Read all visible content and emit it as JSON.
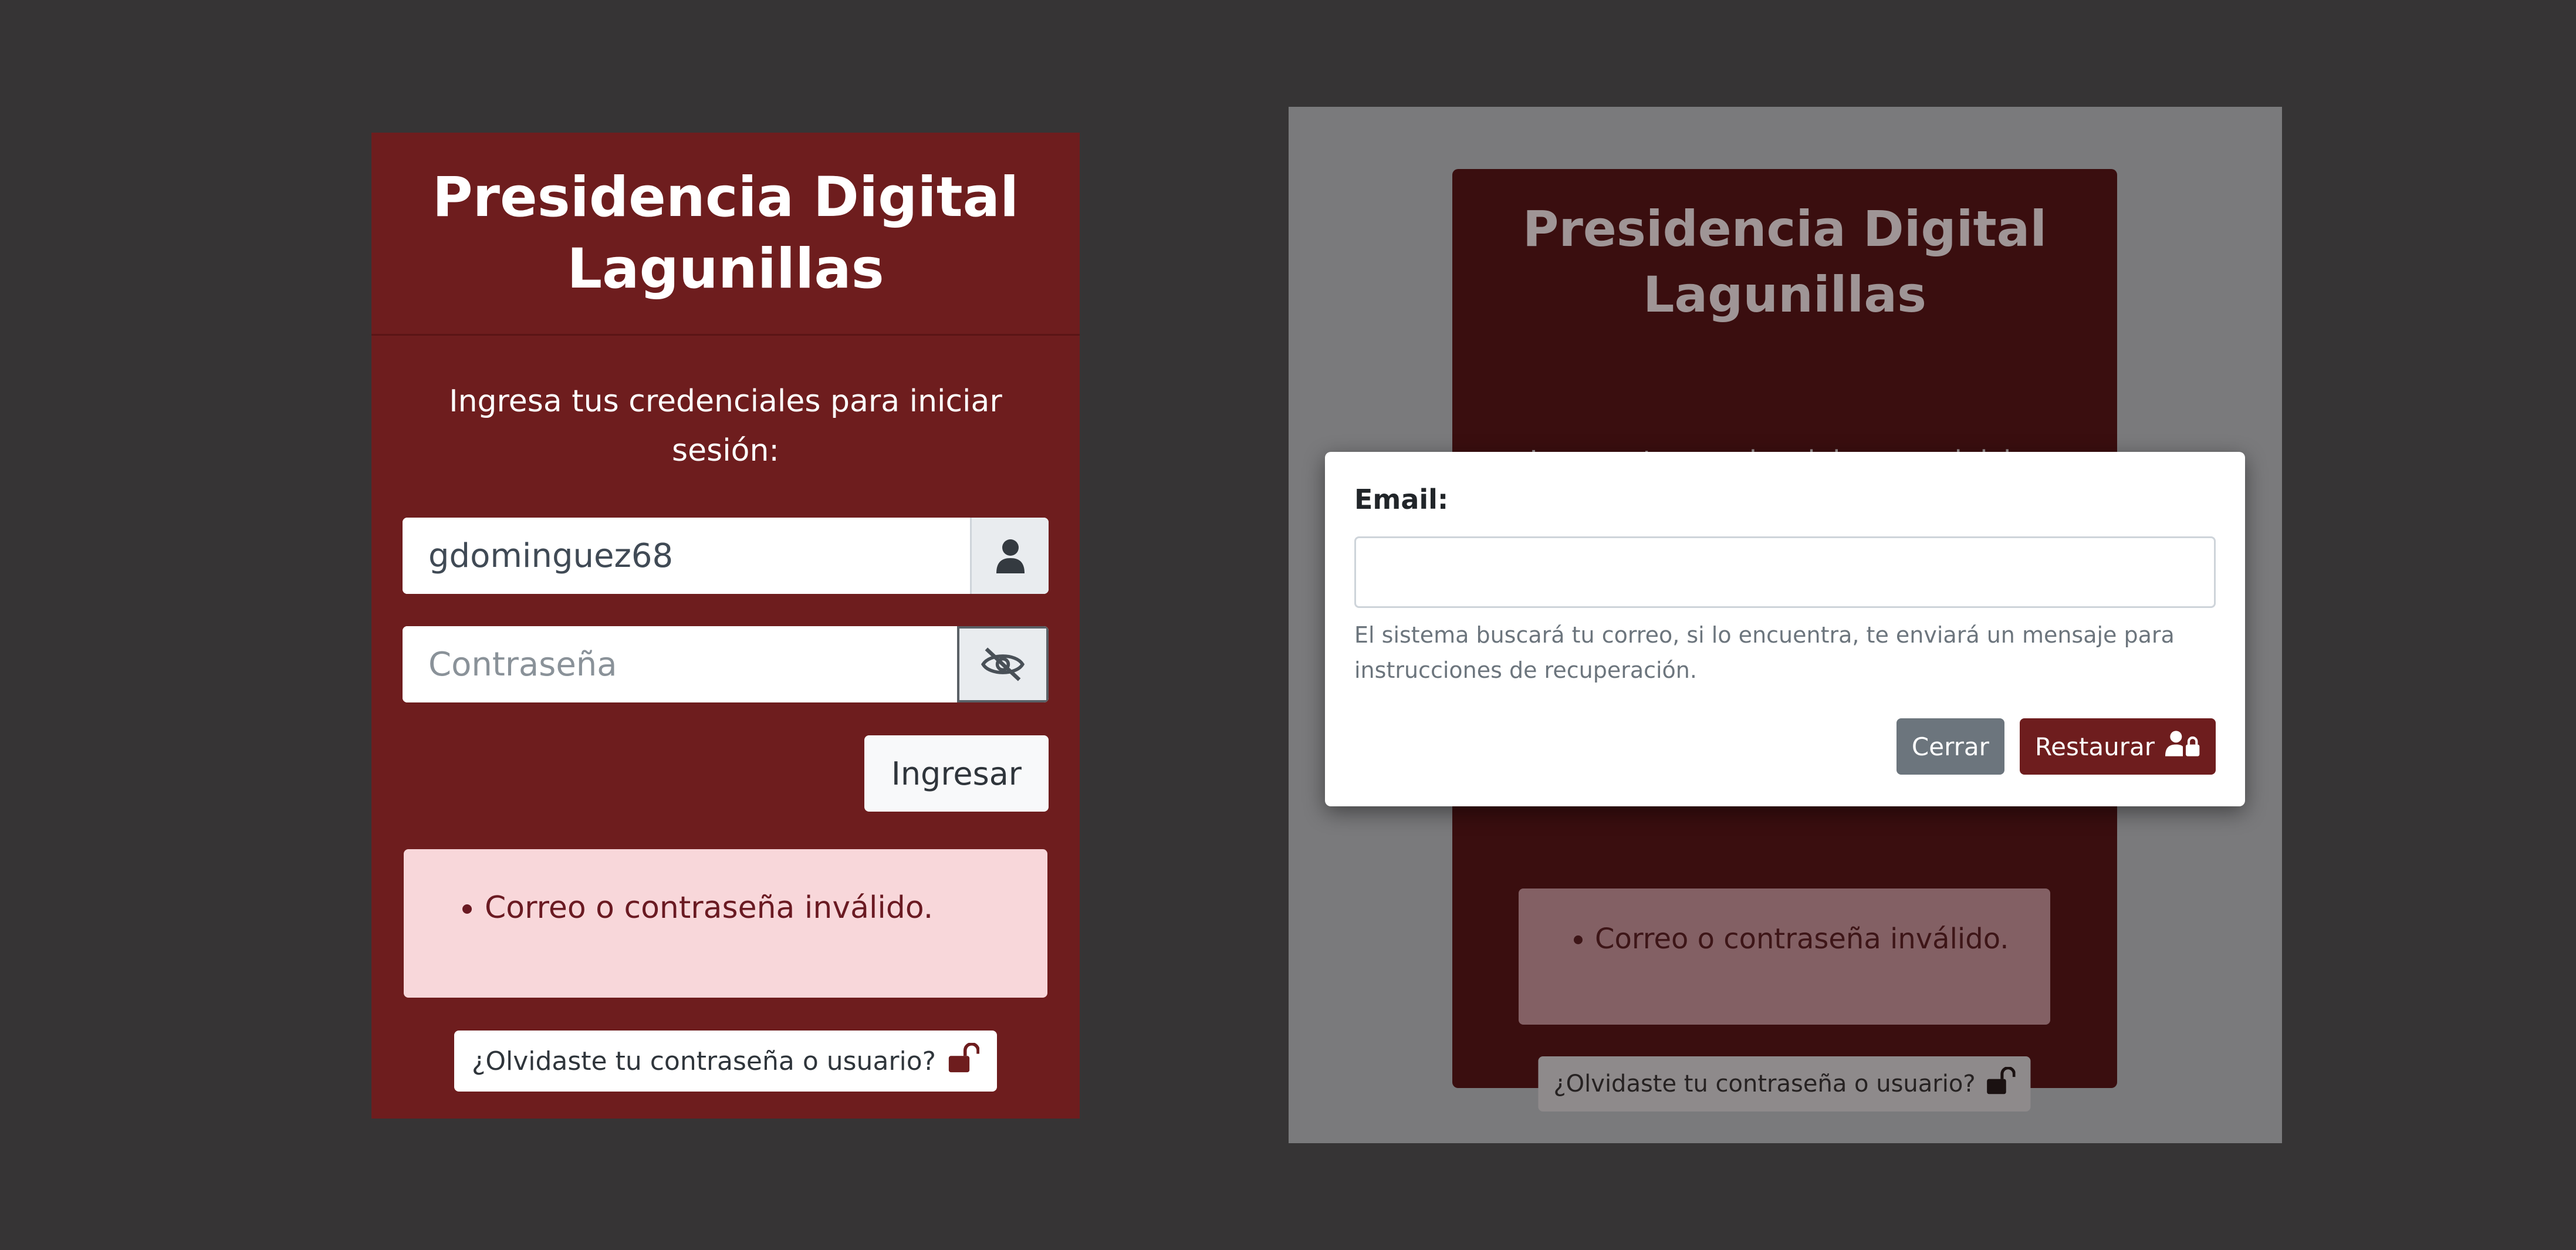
{
  "login": {
    "title_line1": "Presidencia Digital",
    "title_line2": "Lagunillas",
    "instructions": "Ingresa tus credenciales para iniciar sesión:",
    "username_value": "gdominguez68",
    "password_placeholder": "Contraseña",
    "submit_label": "Ingresar",
    "error_message": "Correo o contraseña inválido.",
    "forgot_label": "¿Olvidaste tu contraseña o usuario?"
  },
  "background": {
    "title_line1": "Presidencia Digital",
    "title_line2": "Lagunillas",
    "instructions_partial": "Ingresa tus credenciales para iniciar",
    "error_message": "Correo o contraseña inválido.",
    "forgot_label": "¿Olvidaste tu contraseña o usuario?"
  },
  "modal": {
    "email_label": "Email:",
    "email_value": "",
    "help_text": "El sistema buscará tu correo, si lo encuentra, te enviará un mensaje para instrucciones de recuperación.",
    "close_label": "Cerrar",
    "restore_label": "Restaurar"
  },
  "icons": {
    "user": "user-icon",
    "eye_slash": "eye-slash-icon",
    "unlock": "unlock-icon",
    "user_lock": "user-lock-icon"
  },
  "colors": {
    "brand_maroon": "#6e1d1e",
    "page_background": "#363435",
    "alert_background": "#f8d7da",
    "secondary_button": "#6c757d"
  }
}
